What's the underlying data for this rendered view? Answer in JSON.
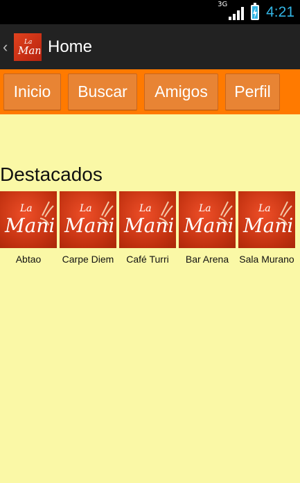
{
  "status_bar": {
    "network_label": "3G",
    "time": "4:21"
  },
  "action_bar": {
    "title": "Home",
    "logo_icon": "la-mani-logo"
  },
  "tabs": [
    {
      "label": "Inicio"
    },
    {
      "label": "Buscar"
    },
    {
      "label": "Amigos"
    },
    {
      "label": "Perfil"
    }
  ],
  "featured": {
    "title": "Destacados",
    "items": [
      {
        "name": "Abtao",
        "logo_text": "La Mani"
      },
      {
        "name": "Carpe Diem",
        "logo_text": "La Mani"
      },
      {
        "name": "Café Turri",
        "logo_text": "La Mani"
      },
      {
        "name": "Bar Arena",
        "logo_text": "La Mani"
      },
      {
        "name": "Sala Murano",
        "logo_text": "La Mani"
      }
    ]
  },
  "colors": {
    "background": "#FAF8A6",
    "tab_bar": "#FF7A00",
    "tab_button": "#E88434",
    "logo_red": "#D63A18",
    "status_accent": "#33B5E5"
  }
}
